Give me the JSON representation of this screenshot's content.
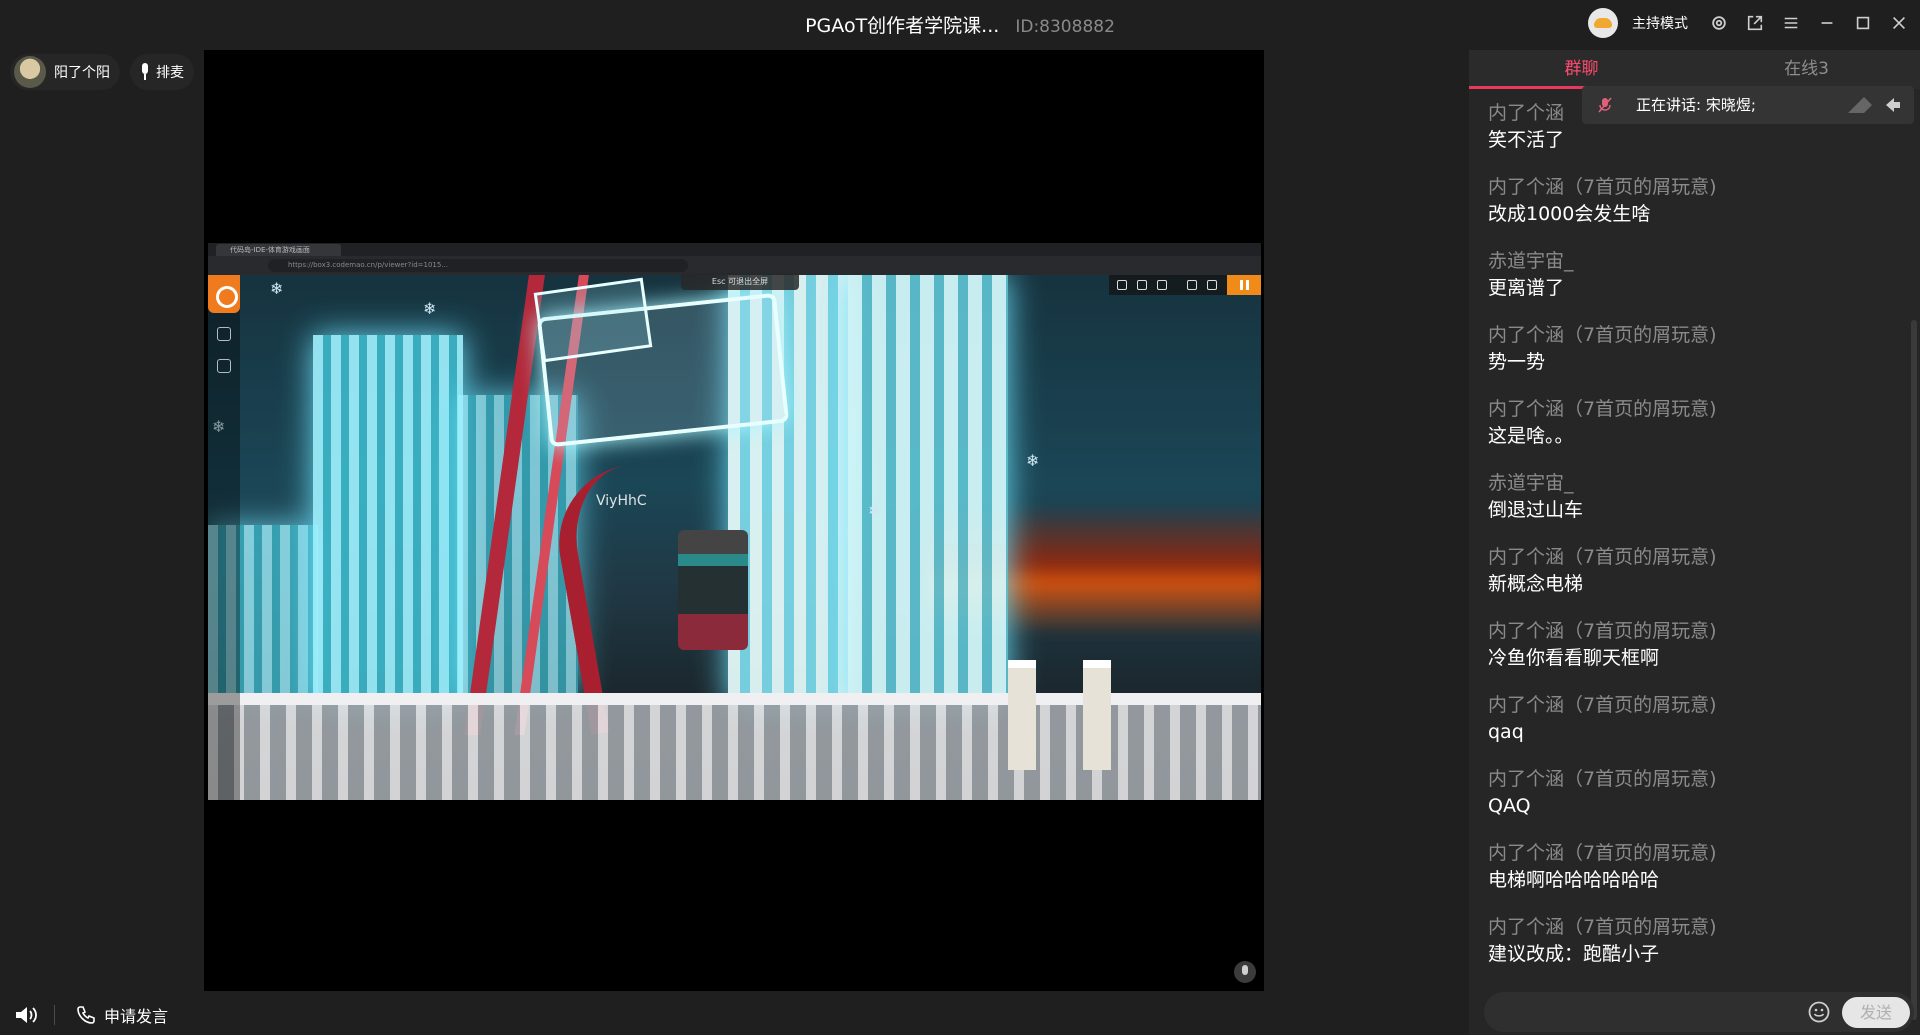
{
  "window": {
    "title": "PGAoT创作者学院课...",
    "room_id": "ID:8308882",
    "host_mode_label": "主持模式"
  },
  "users": {
    "current_user_name": "阳了个阳",
    "queue_label": "排麦"
  },
  "shared_screen": {
    "browser_tab_title": "代码岛-IDE-体育游戏画面",
    "address": "https://box3.codemao.cn/p/viewer?id=1015...",
    "esc_hint": "Esc 可退出全屏",
    "player_name": "ViyHhC"
  },
  "bottom": {
    "apply_speak_label": "申请发言"
  },
  "chat": {
    "tabs": [
      {
        "label": "群聊"
      },
      {
        "label": "在线3"
      }
    ],
    "speaking_notice": "正在讲话: 宋晓煜;",
    "messages": [
      {
        "nick": "内了个涵",
        "text": "笑不活了"
      },
      {
        "nick": "内了个涵（7首页的屑玩意)",
        "text": "改成1000会发生啥"
      },
      {
        "nick": "赤道宇宙_",
        "text": "更离谱了"
      },
      {
        "nick": "内了个涵（7首页的屑玩意)",
        "text": "势一势"
      },
      {
        "nick": "内了个涵（7首页的屑玩意)",
        "text": "这是啥。。"
      },
      {
        "nick": "赤道宇宙_",
        "text": "倒退过山车"
      },
      {
        "nick": "内了个涵（7首页的屑玩意)",
        "text": "新概念电梯"
      },
      {
        "nick": "内了个涵（7首页的屑玩意)",
        "text": "冷鱼你看看聊天框啊"
      },
      {
        "nick": "内了个涵（7首页的屑玩意)",
        "text": "qaq"
      },
      {
        "nick": "内了个涵（7首页的屑玩意)",
        "text": "QAQ"
      },
      {
        "nick": "内了个涵（7首页的屑玩意)",
        "text": "电梯啊哈哈哈哈哈哈"
      },
      {
        "nick": "内了个涵（7首页的屑玩意)",
        "text": "建议改成：跑酷小子"
      }
    ],
    "input_placeholder": "",
    "send_label": "发送"
  },
  "colors": {
    "accent": "#e8385c",
    "background": "#1f1f1f",
    "chat_background": "#262626"
  },
  "icons": {
    "title_bar": [
      "settings-icon",
      "popout-icon",
      "menu-icon",
      "minimize-icon",
      "maximize-icon",
      "close-icon"
    ],
    "bottom": [
      "speaker-icon",
      "phone-icon"
    ],
    "chat": [
      "muted-mic-icon",
      "emoji-icon"
    ]
  }
}
